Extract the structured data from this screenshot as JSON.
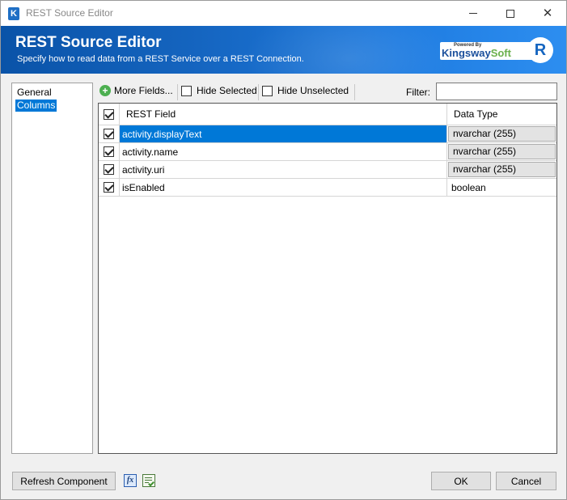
{
  "window": {
    "title": "REST Source Editor",
    "app_icon_letter": "K"
  },
  "banner": {
    "title": "REST Source Editor",
    "subtitle": "Specify how to read data from a REST Service over a REST Connection.",
    "logo_powered": "Powered By",
    "logo_name_main": "Kingsway",
    "logo_name_soft": "Soft",
    "r_logo": "R"
  },
  "nav": {
    "items": [
      {
        "label": "General",
        "selected": false
      },
      {
        "label": "Columns",
        "selected": true
      }
    ]
  },
  "toolbar": {
    "more_fields": "More Fields...",
    "hide_selected": "Hide Selected",
    "hide_unselected": "Hide Unselected",
    "filter_label": "Filter:",
    "filter_value": ""
  },
  "grid": {
    "headers": {
      "field": "REST Field",
      "type": "Data Type"
    },
    "rows": [
      {
        "checked": true,
        "field": "activity.displayText",
        "type": "nvarchar (255)",
        "selected": true
      },
      {
        "checked": true,
        "field": "activity.name",
        "type": "nvarchar (255)",
        "selected": false
      },
      {
        "checked": true,
        "field": "activity.uri",
        "type": "nvarchar (255)",
        "selected": false
      },
      {
        "checked": true,
        "field": "isEnabled",
        "type": "boolean",
        "selected": false
      }
    ]
  },
  "footer": {
    "refresh_label": "Refresh Component",
    "ok_label": "OK",
    "cancel_label": "Cancel",
    "fx_icon_text": "fx"
  },
  "colors": {
    "banner": "#1565c0",
    "selection": "#0078d7"
  }
}
